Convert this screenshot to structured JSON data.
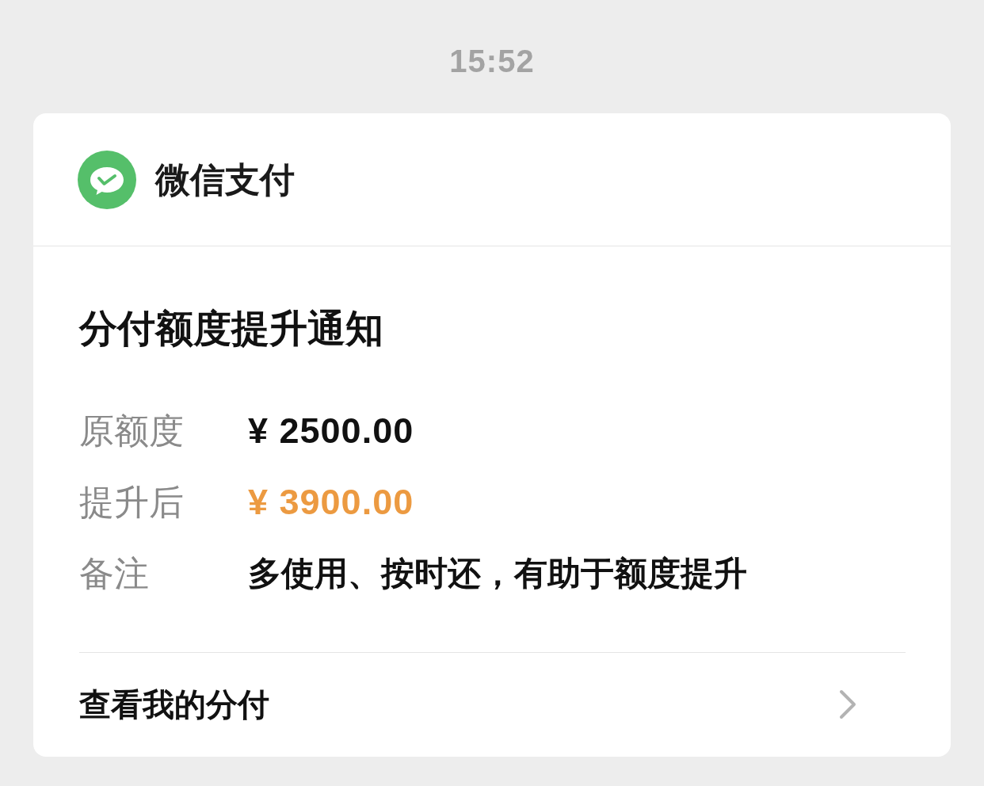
{
  "time": "15:52",
  "header": {
    "title": "微信支付"
  },
  "notice": {
    "title": "分付额度提升通知",
    "rows": [
      {
        "label": "原额度",
        "value": "¥ 2500.00",
        "kind": "amount"
      },
      {
        "label": "提升后",
        "value": "¥ 3900.00",
        "kind": "highlight"
      },
      {
        "label": "备注",
        "value": "多使用、按时还，有助于额度提升",
        "kind": "text"
      }
    ]
  },
  "footer": {
    "link": "查看我的分付"
  }
}
